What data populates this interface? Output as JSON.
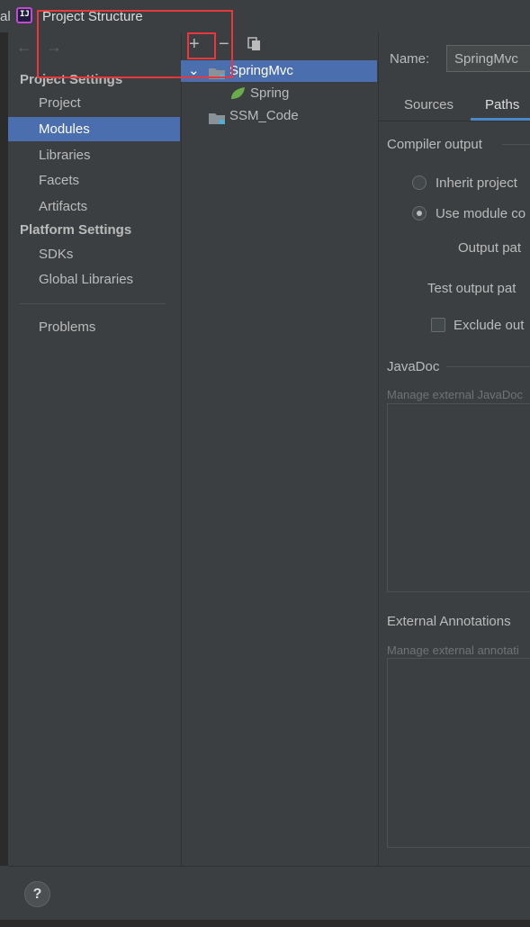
{
  "window": {
    "title": "Project Structure",
    "edge_text": "al"
  },
  "nav": {
    "back_icon": "arrow-left-icon",
    "forward_icon": "arrow-right-icon"
  },
  "sidebar": {
    "project_settings_header": "Project Settings",
    "project_items": [
      {
        "label": "Project"
      },
      {
        "label": "Modules",
        "selected": true
      },
      {
        "label": "Libraries"
      },
      {
        "label": "Facets"
      },
      {
        "label": "Artifacts"
      }
    ],
    "platform_settings_header": "Platform Settings",
    "platform_items": [
      {
        "label": "SDKs"
      },
      {
        "label": "Global Libraries"
      }
    ],
    "problems_label": "Problems"
  },
  "toolbar": {
    "add": "+",
    "remove": "−",
    "copy_icon": "copy-icon"
  },
  "tree": {
    "nodes": [
      {
        "label": "SpringMvc",
        "expanded": true,
        "selected": true,
        "icon": "folder-icon"
      },
      {
        "label": "Spring",
        "icon": "spring-leaf-icon"
      },
      {
        "label": "SSM_Code",
        "icon": "module-folder-icon"
      }
    ]
  },
  "module": {
    "name_label": "Name:",
    "name_value": "SpringMvc",
    "tabs": [
      {
        "label": "Sources"
      },
      {
        "label": "Paths",
        "active": true
      }
    ],
    "compiler_output_label": "Compiler output",
    "inherit_option": "Inherit project",
    "use_module_option": "Use module co",
    "output_path_label": "Output pat",
    "test_output_path_label": "Test output pat",
    "exclude_label": "Exclude out",
    "javadoc_label": "JavaDoc",
    "javadoc_hint": "Manage external JavaDoc",
    "external_annotations_label": "External Annotations",
    "external_annotations_hint": "Manage external annotati"
  },
  "footer": {
    "help": "?"
  },
  "colors": {
    "accent": "#4b6eaf",
    "annotation": "#e8383b",
    "spring": "#6aab4a"
  }
}
